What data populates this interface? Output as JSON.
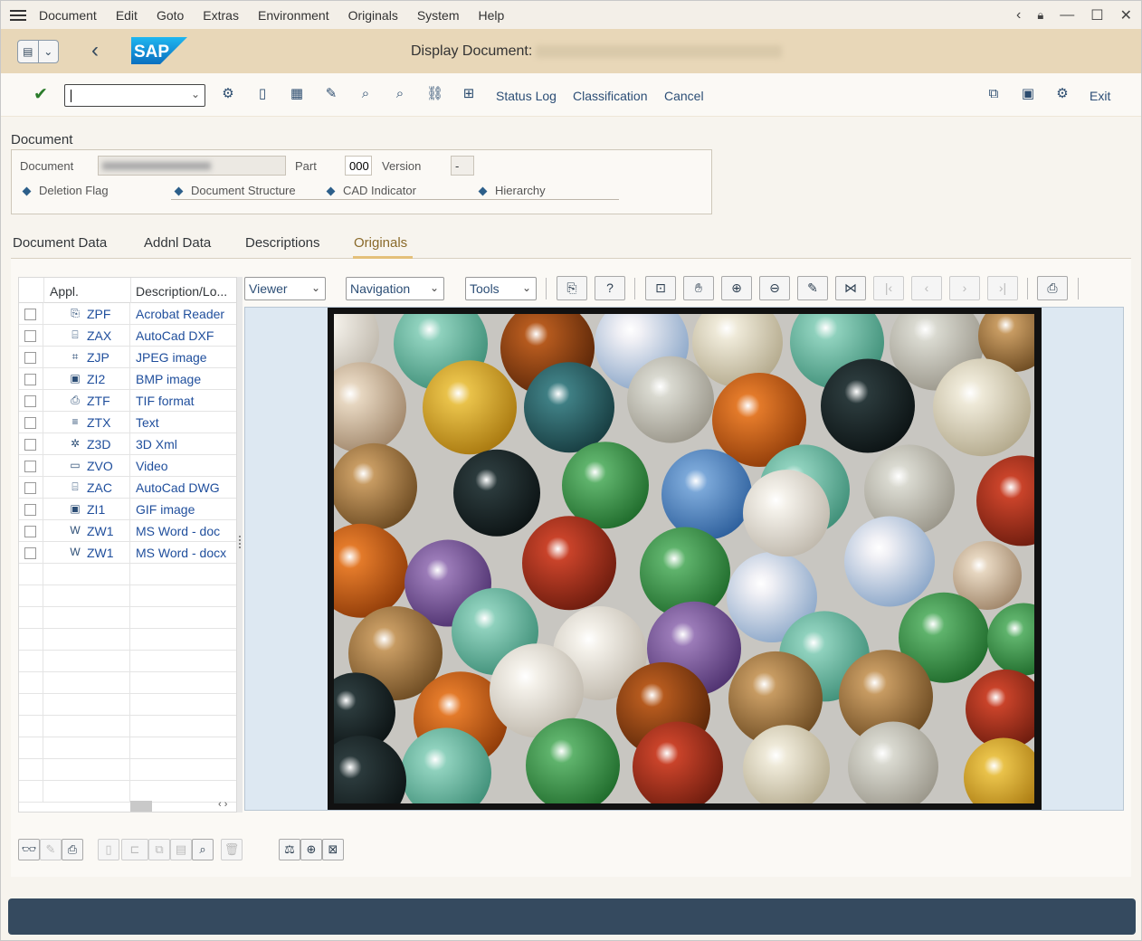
{
  "menubar": {
    "items": [
      "Document",
      "Edit",
      "Goto",
      "Extras",
      "Environment",
      "Originals",
      "System",
      "Help"
    ]
  },
  "titlebar": {
    "title": "Display Document:",
    "logo": "SAP"
  },
  "toolbar": {
    "links": [
      "Status Log",
      "Classification",
      "Cancel"
    ],
    "exit": "Exit"
  },
  "document": {
    "group_label": "Document",
    "doc_label": "Document",
    "part_label": "Part",
    "part_value": "000",
    "version_label": "Version",
    "version_value": "-",
    "radios": [
      "Deletion Flag",
      "Document Structure",
      "CAD Indicator",
      "Hierarchy"
    ]
  },
  "tabs": [
    "Document Data",
    "Addnl Data",
    "Descriptions",
    "Originals"
  ],
  "originals_table": {
    "headers": [
      "Appl.",
      "Description/Lo..."
    ],
    "rows": [
      {
        "appl": "ZPF",
        "desc": "Acrobat Reader",
        "icon": "pdf-icon"
      },
      {
        "appl": "ZAX",
        "desc": "AutoCad DXF",
        "icon": "cad-icon"
      },
      {
        "appl": "ZJP",
        "desc": "JPEG image",
        "icon": "jpeg-icon"
      },
      {
        "appl": "ZI2",
        "desc": "BMP image",
        "icon": "image-icon"
      },
      {
        "appl": "ZTF",
        "desc": "TIF format",
        "icon": "tif-icon"
      },
      {
        "appl": "ZTX",
        "desc": "Text",
        "icon": "text-icon"
      },
      {
        "appl": "Z3D",
        "desc": "3D Xml",
        "icon": "3d-icon"
      },
      {
        "appl": "ZVO",
        "desc": "Video",
        "icon": "video-icon"
      },
      {
        "appl": "ZAC",
        "desc": "AutoCad DWG",
        "icon": "cad-icon"
      },
      {
        "appl": "ZI1",
        "desc": "GIF image",
        "icon": "image-icon"
      },
      {
        "appl": "ZW1",
        "desc": "MS Word - doc",
        "icon": "word-icon"
      },
      {
        "appl": "ZW1",
        "desc": "MS Word - docx",
        "icon": "word-icon"
      }
    ]
  },
  "viewer": {
    "dropdowns": [
      "Viewer",
      "Navigation",
      "Tools"
    ]
  },
  "colors": {
    "titlebar": "#e8d7b8",
    "menubar": "#f3efe8",
    "link": "#1f4e9c",
    "statusbar": "#354a5f",
    "accent_tab": "#e4c07a"
  }
}
